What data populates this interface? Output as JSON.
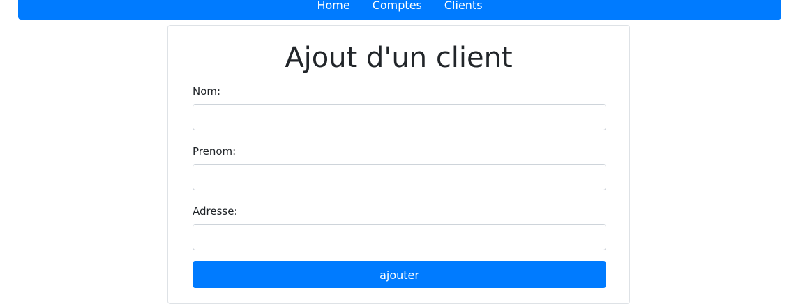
{
  "nav": {
    "items": [
      {
        "label": "Home"
      },
      {
        "label": "Comptes"
      },
      {
        "label": "Clients"
      }
    ]
  },
  "form": {
    "title": "Ajout d'un client",
    "fields": [
      {
        "label": "Nom:",
        "value": "",
        "placeholder": ""
      },
      {
        "label": "Prenom:",
        "value": "",
        "placeholder": ""
      },
      {
        "label": "Adresse:",
        "value": "",
        "placeholder": ""
      }
    ],
    "submit_label": "ajouter"
  },
  "colors": {
    "primary": "#007bff",
    "border": "#ced4da",
    "text": "#212529"
  }
}
